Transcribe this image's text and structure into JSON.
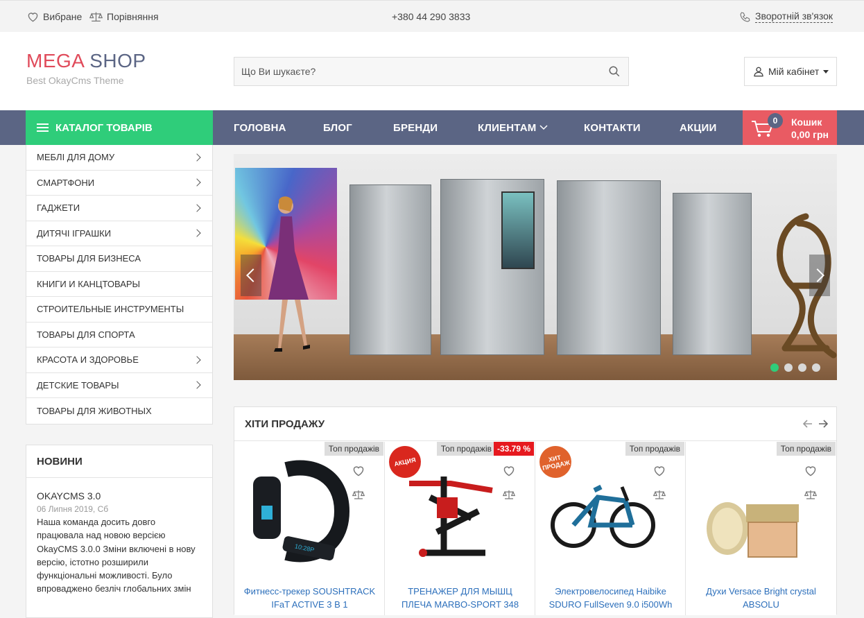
{
  "topbar": {
    "favorites": "Вибране",
    "compare": "Порівняння",
    "phone": "+380 44 290 3833",
    "callback": "Зворотній зв'язок"
  },
  "header": {
    "logo_part1": "MEGA",
    "logo_part2": "SHOP",
    "logo_tagline": "Best OkayCms Theme",
    "search_placeholder": "Що Ви шукаєте?",
    "account_label": "Мій кабінет"
  },
  "nav": {
    "catalog_label": "КАТАЛОГ ТОВАРІВ",
    "items": [
      "ГОЛОВНА",
      "БЛОГ",
      "БРЕНДИ",
      "КЛИЕНТАМ",
      "КОНТАКТИ",
      "АКЦИИ"
    ],
    "cart_count": "0",
    "cart_label": "Кошик",
    "cart_total": "0,00 грн"
  },
  "categories": [
    {
      "label": "МЕБЛІ ДЛЯ ДОМУ",
      "has_sub": true
    },
    {
      "label": "СМАРТФОНИ",
      "has_sub": true
    },
    {
      "label": "ГАДЖЕТИ",
      "has_sub": true
    },
    {
      "label": "ДИТЯЧІ ІГРАШКИ",
      "has_sub": true
    },
    {
      "label": "ТОВАРЫ ДЛЯ БИЗНЕСА",
      "has_sub": false
    },
    {
      "label": "КНИГИ И КАНЦТОВАРЫ",
      "has_sub": false
    },
    {
      "label": "СТРОИТЕЛЬНЫЕ ИНСТРУМЕНТЫ",
      "has_sub": false
    },
    {
      "label": "ТОВАРЫ ДЛЯ СПОРТА",
      "has_sub": false
    },
    {
      "label": "КРАСОТА И ЗДОРОВЬЕ",
      "has_sub": true
    },
    {
      "label": "ДЕТСКИЕ ТОВАРЫ",
      "has_sub": true
    },
    {
      "label": "ТОВАРЫ ДЛЯ ЖИВОТНЫХ",
      "has_sub": false
    }
  ],
  "news": {
    "title": "НОВИНИ",
    "item_title": "OKAYCMS 3.0",
    "item_date": "06 Липня 2019, Сб",
    "item_text": "Наша команда досить довго працювала над новою версією OkayCMS 3.0.0 Зміни включені в нову версію, істотно розширили функціональні можливості. Було впроваджено безліч глобальних змін"
  },
  "slider": {
    "active_index": 0,
    "dots": 4
  },
  "hits": {
    "title": "ХІТИ ПРОДАЖУ",
    "products": [
      {
        "name": "Фитнесс-трекер SOUSHTRACK IFaT ACTIVE 3 В 1",
        "badge": "Топ продажів",
        "discount": "",
        "stamp": ""
      },
      {
        "name": "ТРЕНАЖЕР ДЛЯ МЫШЦ ПЛЕЧА MARBO-SPORT 348",
        "badge": "Топ продажів",
        "discount": "-33.79 %",
        "stamp": "АКЦИЯ"
      },
      {
        "name": "Электровелосипед Haibike SDURO FullSeven 9.0 i500Wh",
        "badge": "Топ продажів",
        "discount": "",
        "stamp": "ХИТ ПРОДАЖ"
      },
      {
        "name": "Духи Versace Bright crystal ABSOLU",
        "badge": "Топ продажів",
        "discount": "",
        "stamp": ""
      }
    ]
  },
  "colors": {
    "accent_green": "#2fcd7a",
    "nav_blue": "#5b6584",
    "cart_red": "#e95b63",
    "logo_red": "#e04a5a",
    "link_blue": "#2c6fbb"
  }
}
